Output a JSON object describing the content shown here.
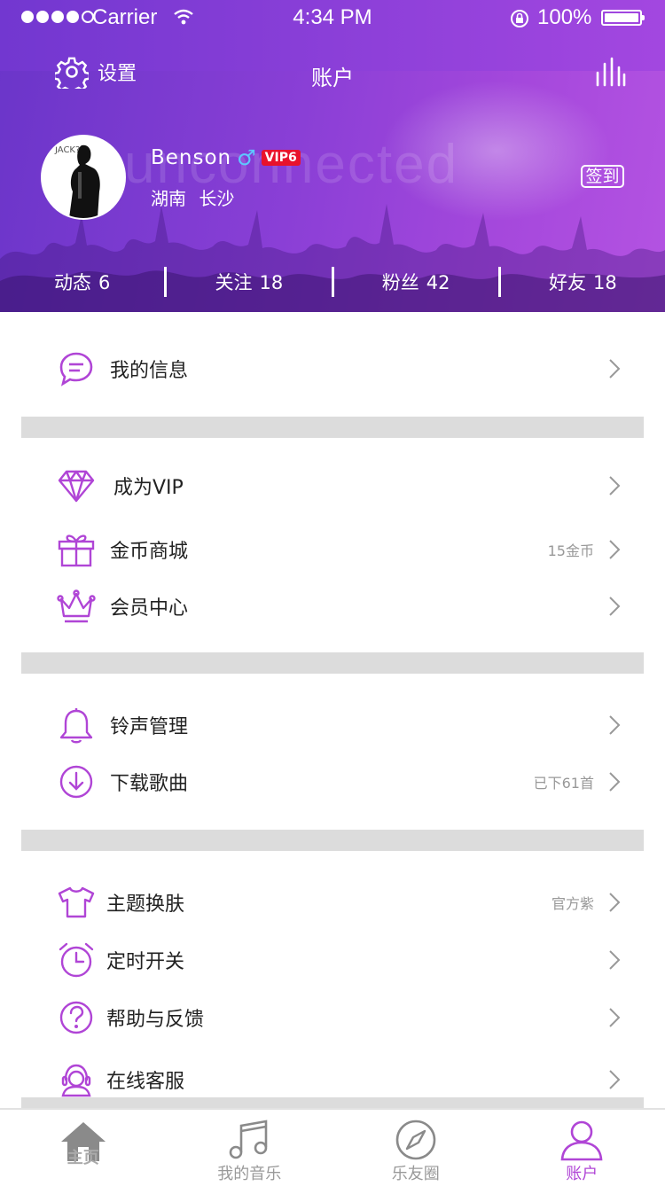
{
  "status_bar": {
    "carrier": "Carrier",
    "time": "4:34 PM",
    "battery": "100%"
  },
  "navbar": {
    "settings_label": "设置",
    "title": "账户"
  },
  "profile": {
    "watermark": "unconnected",
    "name": "Benson",
    "gender_symbol": "♂",
    "vip_badge": "VIP6",
    "location": "湖南 长沙",
    "signin_label": "签到"
  },
  "stats": [
    {
      "label": "动态",
      "value": "6"
    },
    {
      "label": "关注",
      "value": "18"
    },
    {
      "label": "粉丝",
      "value": "42"
    },
    {
      "label": "好友",
      "value": "18"
    }
  ],
  "menu": {
    "messages": {
      "label": "我的信息",
      "icon": "chat-bubble-icon"
    },
    "vip": {
      "label": "成为VIP",
      "icon": "diamond-icon"
    },
    "coin_shop": {
      "label": "金币商城",
      "note": "15金币",
      "icon": "gift-icon"
    },
    "member_center": {
      "label": "会员中心",
      "icon": "crown-icon"
    },
    "ringtones": {
      "label": "铃声管理",
      "icon": "bell-icon"
    },
    "downloads": {
      "label": "下载歌曲",
      "note": "已下61首",
      "icon": "download-icon"
    },
    "theme": {
      "label": "主题换肤",
      "note": "官方紫",
      "icon": "tshirt-icon"
    },
    "timer": {
      "label": "定时开关",
      "icon": "alarm-clock-icon"
    },
    "help": {
      "label": "帮助与反馈",
      "icon": "question-icon"
    },
    "support": {
      "label": "在线客服",
      "icon": "headset-icon"
    }
  },
  "tabbar": {
    "home": "主页",
    "my_music": "我的音乐",
    "friends": "乐友圈",
    "account": "账户"
  },
  "colors": {
    "accent": "#b045d6",
    "header_start": "#6a35c9",
    "header_end": "#b453e2",
    "vip_red": "#e8122c",
    "divider": "#dcdcdc"
  }
}
